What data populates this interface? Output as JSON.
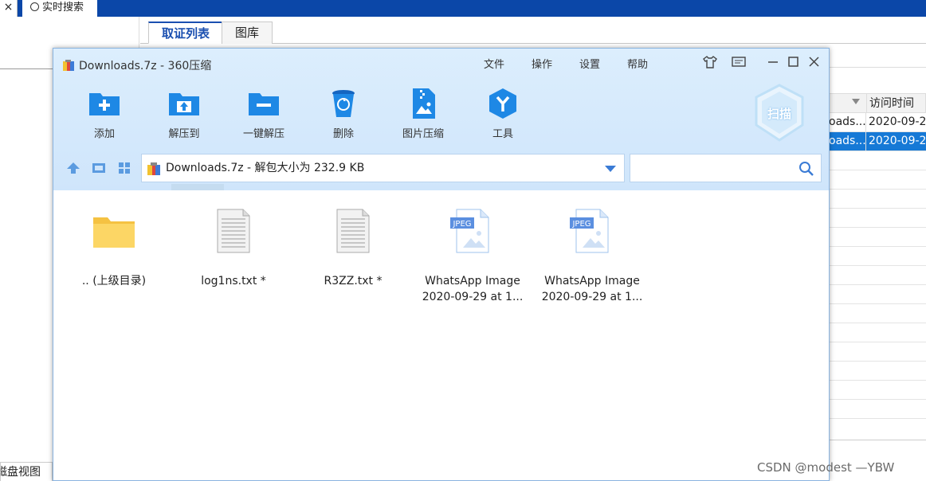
{
  "background_app": {
    "close_tab_label": "×",
    "search_tab_label": "实时搜索",
    "tabs": [
      {
        "label": "取证列表",
        "active": true
      },
      {
        "label": "图库",
        "active": false
      }
    ],
    "table": {
      "header_col2": "访问时间",
      "rows": [
        {
          "c1": "oads...",
          "c2": "2020-09-2",
          "selected": false
        },
        {
          "c1": "oads...",
          "c2": "2020-09-2",
          "selected": true
        }
      ]
    },
    "bottom_tab_label": "磁盘视图"
  },
  "window": {
    "title": "Downloads.7z - 360压缩",
    "menu": [
      "文件",
      "操作",
      "设置",
      "帮助"
    ],
    "toolbar": [
      {
        "label": "添加",
        "icon": "add-folder-icon"
      },
      {
        "label": "解压到",
        "icon": "extract-to-icon"
      },
      {
        "label": "一键解压",
        "icon": "one-click-extract-icon"
      },
      {
        "label": "删除",
        "icon": "recycle-bin-icon"
      },
      {
        "label": "图片压缩",
        "icon": "image-compress-icon"
      },
      {
        "label": "工具",
        "icon": "tools-icon"
      }
    ],
    "scan_label": "扫描",
    "path": "Downloads.7z - 解包大小为 232.9 KB",
    "search_placeholder": "",
    "files": [
      {
        "name_line1": ".. (上级目录)",
        "name_line2": "",
        "type": "folder"
      },
      {
        "name_line1": "log1ns.txt *",
        "name_line2": "",
        "type": "txt"
      },
      {
        "name_line1": "R3ZZ.txt *",
        "name_line2": "",
        "type": "txt"
      },
      {
        "name_line1": "WhatsApp Image",
        "name_line2": "2020-09-29 at 1...",
        "type": "jpeg"
      },
      {
        "name_line1": "WhatsApp Image",
        "name_line2": "2020-09-29 at 1...",
        "type": "jpeg"
      }
    ]
  },
  "watermark": "CSDN @modest —YBW",
  "colors": {
    "accent": "#1a4fb0",
    "topbar": "#0b47a8",
    "selection": "#1679d6",
    "toolbar_icon": "#1e88e5"
  }
}
